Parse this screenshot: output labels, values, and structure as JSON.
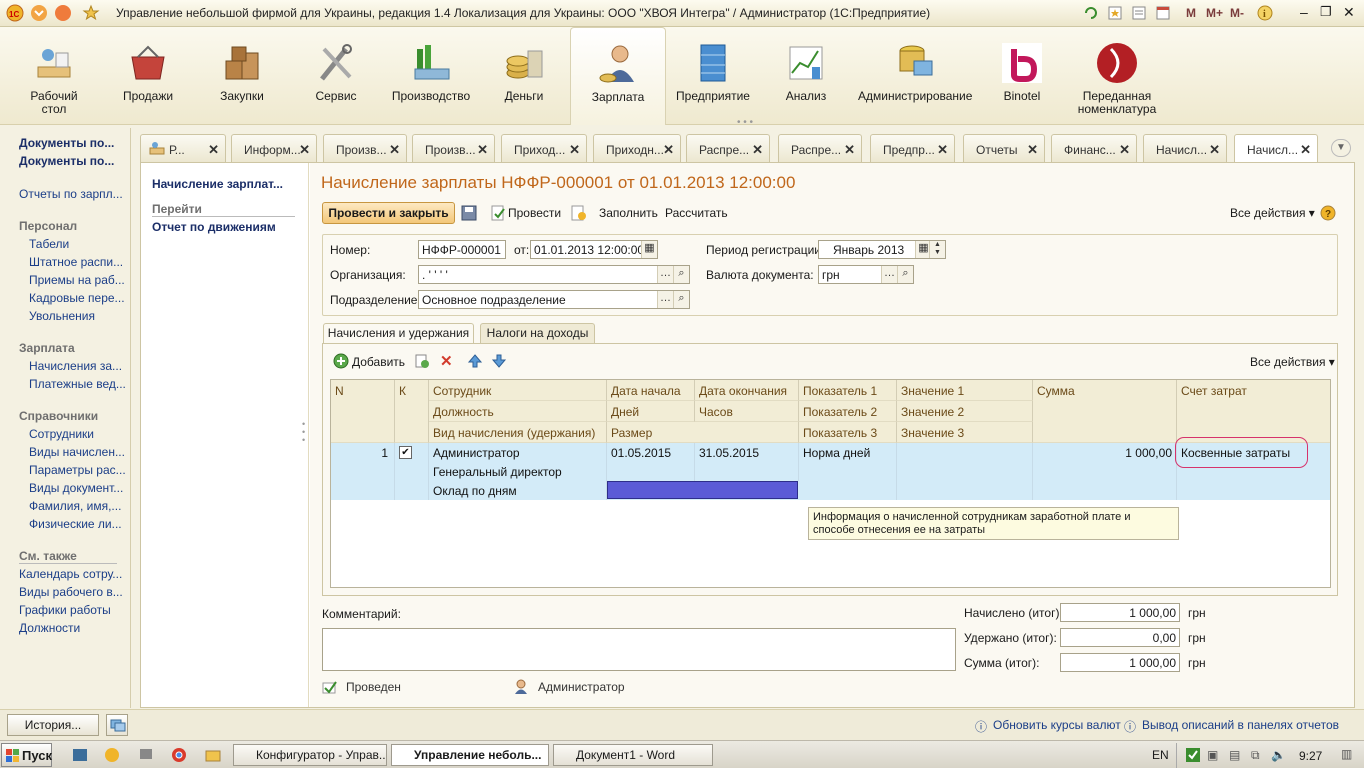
{
  "window": {
    "title": "Управление небольшой фирмой для Украины, редакция 1.4 Локализация для Украины: ООО \"ХВОЯ Интегра\" / Администратор  (1С:Предприятие)",
    "title_icons": [
      "M",
      "M+",
      "M-"
    ]
  },
  "sections": [
    {
      "label": "Рабочий стол",
      "icon": "desk-icon"
    },
    {
      "label": "Продажи",
      "icon": "basket-icon"
    },
    {
      "label": "Закупки",
      "icon": "boxes-icon"
    },
    {
      "label": "Сервис",
      "icon": "tools-icon"
    },
    {
      "label": "Производство",
      "icon": "factory-icon"
    },
    {
      "label": "Деньги",
      "icon": "coins-icon"
    },
    {
      "label": "Зарплата",
      "icon": "person-icon"
    },
    {
      "label": "Предприятие",
      "icon": "building-icon"
    },
    {
      "label": "Анализ",
      "icon": "chart-icon"
    },
    {
      "label": "Администрирование",
      "icon": "server-icon"
    },
    {
      "label": "Binotel",
      "icon": "binotel-icon"
    },
    {
      "label": "Переданная номенклатура",
      "icon": "coffee-bean-icon"
    }
  ],
  "leftnav": {
    "docs1": "Документы по...",
    "docs2": "Документы по...",
    "reports": "Отчеты по зарпл...",
    "g1": "Персонал",
    "g1_items": [
      "Табели",
      "Штатное распи...",
      "Приемы на раб...",
      "Кадровые пере...",
      "Увольнения"
    ],
    "g2": "Зарплата",
    "g2_items": [
      "Начисления за...",
      "Платежные вед..."
    ],
    "g3": "Справочники",
    "g3_items": [
      "Сотрудники",
      "Виды начислен...",
      "Параметры рас...",
      "Виды документ...",
      "Фамилия, имя,...",
      "Физические ли..."
    ],
    "g4": "См. также",
    "g4_items": [
      "Календарь сотру...",
      "Виды рабочего в...",
      "Графики работы",
      "Должности"
    ]
  },
  "tabs": [
    "Р...",
    "Информ...",
    "Произв...",
    "Произв...",
    "Приход...",
    "Приходн...",
    "Распре...",
    "Распре...",
    "Предпр...",
    "Отчеты",
    "Финанс...",
    "Начисл...",
    "Начисл..."
  ],
  "side": {
    "title": "Начисление зарплат...",
    "goto": "Перейти",
    "link": "Отчет по движениям"
  },
  "doc": {
    "title": "Начисление зарплаты НФФР-000001 от 01.01.2013 12:00:00",
    "btn_post_close": "Провести и закрыть",
    "btn_post": "Провести",
    "btn_fill": "Заполнить",
    "btn_calc": "Рассчитать",
    "all_actions": "Все действия",
    "number_label": "Номер:",
    "number": "НФФР-000001",
    "from_label": "от:",
    "date": "01.01.2013 12:00:00",
    "period_label": "Период регистрации:",
    "period": "Январь 2013",
    "org_label": "Организация:",
    "org": ".         ' ' ' '",
    "currency_label": "Валюта документа:",
    "currency": "грн",
    "dept_label": "Подразделение:",
    "dept": "Основное подразделение"
  },
  "inner_tabs": [
    "Начисления и удержания",
    "Налоги на доходы"
  ],
  "grid": {
    "add_label": "Добавить",
    "all_actions": "Все действия",
    "headers": {
      "n": "N",
      "k": "К",
      "c1": [
        "Сотрудник",
        "Должность",
        "Вид начисления (удержания)"
      ],
      "c2": [
        "Дата начала",
        "Дней",
        "Размер"
      ],
      "c3": [
        "Дата окончания",
        "Часов"
      ],
      "c4": [
        "Показатель 1",
        "Показатель 2",
        "Показатель 3"
      ],
      "c5": [
        "Значение 1",
        "Значение 2",
        "Значение 3"
      ],
      "sum": "Сумма",
      "acct": "Счет затрат"
    },
    "row": {
      "n": "1",
      "checked": true,
      "employee": "Администратор",
      "position": "Генеральный директор",
      "kind": "Оклад по дням",
      "start": "01.05.2015",
      "end": "31.05.2015",
      "ind1": "Норма дней",
      "sum": "1 000,00",
      "acct": "Косвенные затраты"
    },
    "tooltip": "Информация о начисленной сотрудникам заработной плате и способе отнесения ее на затраты"
  },
  "bottom": {
    "comment_label": "Комментарий:",
    "accrued_label": "Начислено (итог):",
    "accrued": "1 000,00",
    "withheld_label": "Удержано (итог):",
    "withheld": "0,00",
    "total_label": "Сумма (итог):",
    "total": "1 000,00",
    "currency": "грн",
    "status": "Проведен",
    "author": "Администратор"
  },
  "statusbar": {
    "history": "История...",
    "link1": "Обновить курсы валют",
    "link2": "Вывод описаний в панелях отчетов"
  },
  "taskbar": {
    "start": "Пуск",
    "tasks": [
      "Конфигуратор - Управ...",
      "Управление неболь...",
      "Документ1 - Word"
    ],
    "lang": "EN",
    "time": "9:27"
  },
  "colors": {
    "accent": "#c0671b",
    "selection": "#d3ebf8",
    "highlight": "#5b5bd6",
    "circle": "#d6336c"
  }
}
